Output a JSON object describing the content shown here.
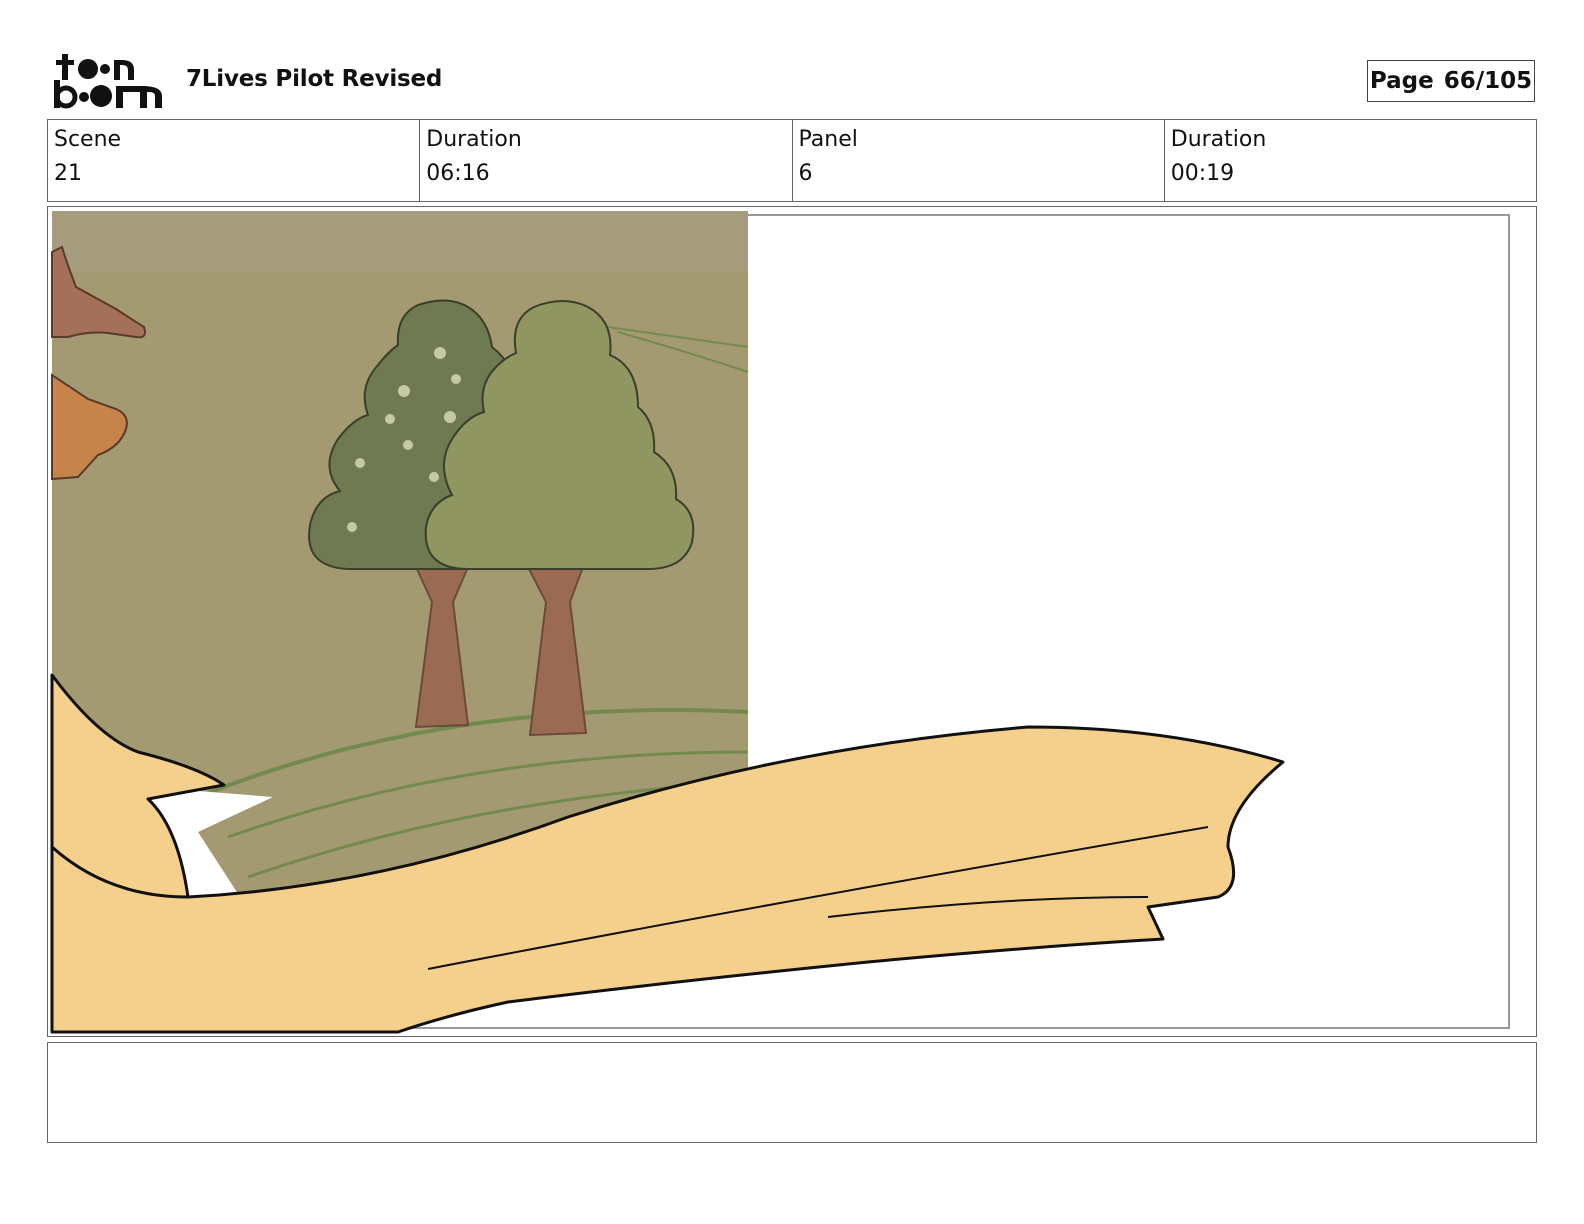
{
  "header": {
    "logo_text": "toonboom",
    "project_title": "7Lives Pilot Revised",
    "page_label": "Page",
    "page_value": "66/105"
  },
  "info": {
    "scene_label": "Scene",
    "scene_value": "21",
    "scene_duration_label": "Duration",
    "scene_duration_value": "06:16",
    "panel_label": "Panel",
    "panel_value": "6",
    "panel_duration_label": "Duration",
    "panel_duration_value": "00:19"
  },
  "notes": {
    "text": ""
  },
  "colors": {
    "background_paper": "#a49a72",
    "tree_dark": "#6f7a52",
    "tree_light": "#8f9660",
    "trunk": "#9b6a52",
    "fabric": "#f5d08c",
    "outline": "#111111"
  }
}
